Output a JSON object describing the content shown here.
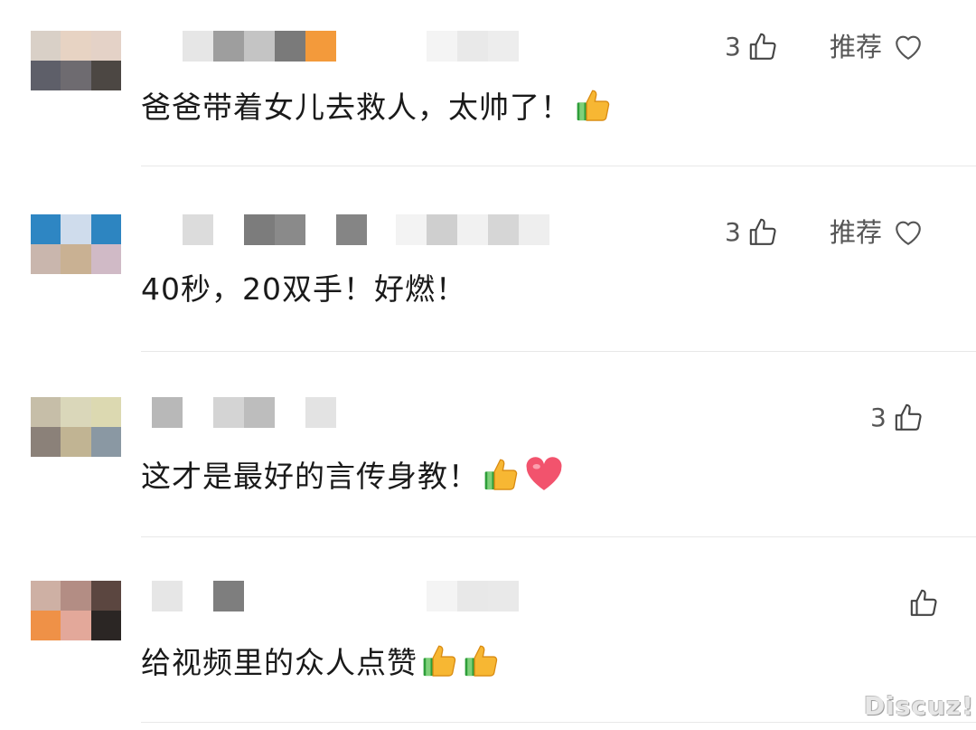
{
  "comments": [
    {
      "text": "爸爸带着女儿去救人，太帅了！",
      "likes": "3",
      "recommend_label": "推荐",
      "emojis": [
        "thumbs-up"
      ],
      "avatar_colors": [
        "#d9d0c7",
        "#e7d3c3",
        "#e4d2c7",
        "#5e5f69",
        "#6e6b70",
        "#4c4743"
      ]
    },
    {
      "text": "40秒，20双手！好燃！",
      "likes": "3",
      "recommend_label": "推荐",
      "emojis": [],
      "avatar_colors": [
        "#2e86c3",
        "#cfdcec",
        "#2d85c1",
        "#c9b6ad",
        "#c9b193",
        "#d0bac6"
      ]
    },
    {
      "text": "这才是最好的言传身教！",
      "likes": "3",
      "recommend_label": "",
      "emojis": [
        "thumbs-up",
        "red-heart"
      ],
      "avatar_colors": [
        "#c6bea8",
        "#dad7ba",
        "#dcd9b1",
        "#8b8179",
        "#c1b493",
        "#8a98a3"
      ]
    },
    {
      "text": "给视频里的众人点赞",
      "likes": "",
      "recommend_label": "",
      "emojis": [
        "thumbs-up",
        "thumbs-up"
      ],
      "avatar_colors": [
        "#ceb0a4",
        "#b38d84",
        "#5b4640",
        "#ef9147",
        "#e3a89a",
        "#2b2624"
      ]
    }
  ],
  "watermark": "Discuz!"
}
